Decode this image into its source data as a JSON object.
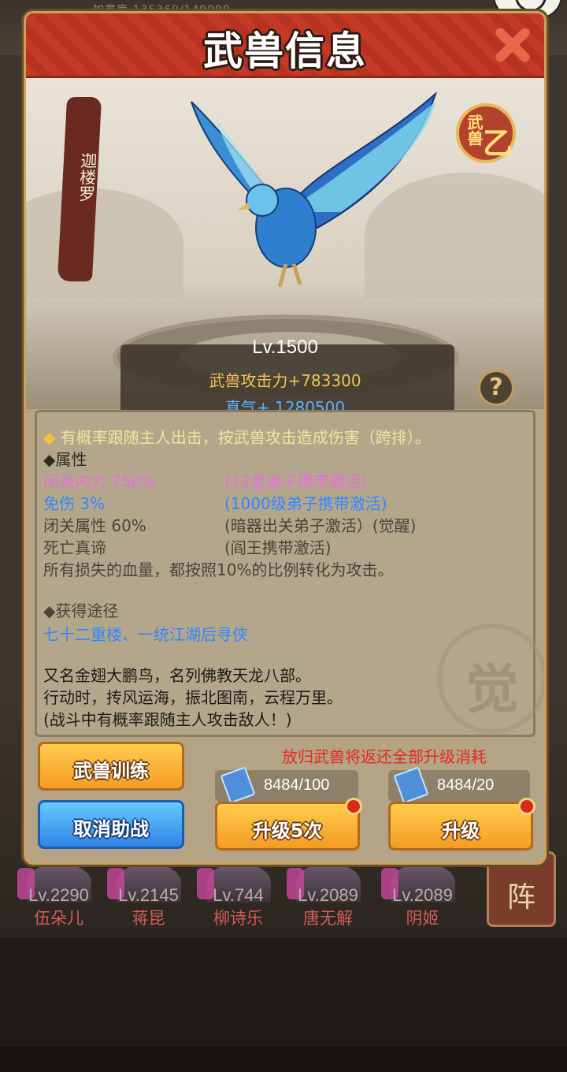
{
  "background": {
    "top_stat_text": "如意度 135369/149999",
    "heroes": [
      {
        "level": "Lv.2290",
        "name": "伍朵儿"
      },
      {
        "level": "Lv.2145",
        "name": "蒋昆"
      },
      {
        "level": "Lv.744",
        "name": "柳诗乐"
      },
      {
        "level": "Lv.2089",
        "name": "唐无解"
      },
      {
        "level": "Lv.2089",
        "name": "阴姬"
      }
    ],
    "formation_label": "阵"
  },
  "modal": {
    "title": "武兽信息",
    "beast_name": "迦楼罗",
    "grade": {
      "top": "武兽",
      "mark": "乙"
    },
    "level": "Lv.1500",
    "attack": "武兽攻击力+783300",
    "qi": "真气+ 1280500",
    "help_label": "?",
    "description": "有概率跟随主人出击，按武兽攻击造成伤害（跨排）。",
    "attributes_heading": "◆属性",
    "attributes": [
      {
        "name": "闭关内力 750%",
        "condition": "(12星弟子携带激活)",
        "color": "pink"
      },
      {
        "name": "免伤 3%",
        "condition": "(1000级弟子携带激活)",
        "color": "blue"
      },
      {
        "name": "闭关属性 60%",
        "condition": "(暗器出关弟子激活）(觉醒)",
        "color": "gray"
      },
      {
        "name": "死亡真谛",
        "condition": "(阎王携带激活)",
        "color": "gray"
      }
    ],
    "special_text": "所有损失的血量，都按照10%的比例转化为攻击。",
    "obtain_heading": "◆获得途径",
    "obtain_text": "七十二重楼、一统江湖后寻侠",
    "lore": [
      "又名金翅大鹏鸟，名列佛教天龙八部。",
      "行动时，抟风运海，振北图南，云程万里。",
      "(战斗中有概率跟随主人攻击敌人！)"
    ],
    "seal_text": "觉",
    "release_note": "放归武兽将返还全部升级消耗",
    "buttons": {
      "train": "武兽训练",
      "cancel_assist": "取消助战",
      "upgrade5": "升级5次",
      "upgrade": "升级"
    },
    "costs": {
      "upgrade5": "8484/100",
      "upgrade": "8484/20"
    }
  }
}
